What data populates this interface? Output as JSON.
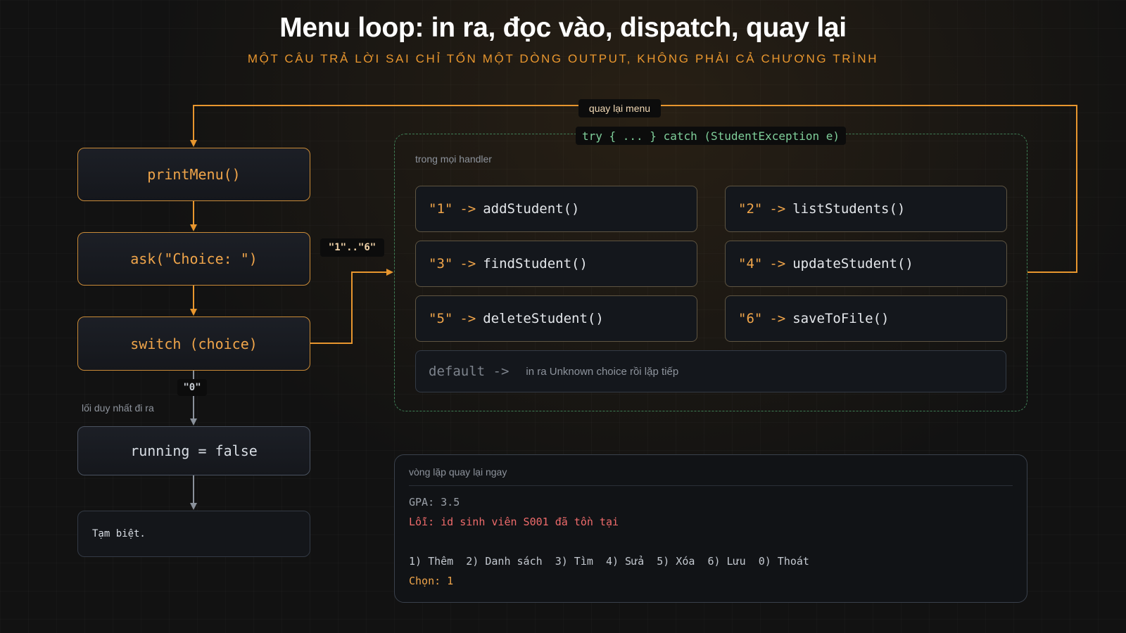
{
  "header": {
    "title": "Menu loop: in ra, đọc vào, dispatch, quay lại",
    "subtitle": "MỘT CÂU TRẢ LỜI SAI CHỈ TỐN MỘT DÒNG OUTPUT, KHÔNG PHẢI CẢ CHƯƠNG TRÌNH"
  },
  "flow": {
    "print_menu": "printMenu()",
    "ask": "ask(\"Choice: \")",
    "switch": "switch (choice)",
    "running_false": "running = false",
    "goodbye": "Tạm biệt."
  },
  "edges": {
    "loop_back": "quay lại menu",
    "range": "\"1\"..\"6\"",
    "zero": "\"0\"",
    "exit_note": "lối duy nhất đi ra"
  },
  "try_block": {
    "label": "try { ... } catch (StudentException e)",
    "note": "trong mọi handler",
    "cases": [
      {
        "key": "\"1\"",
        "arrow": "->",
        "fn": "addStudent()"
      },
      {
        "key": "\"2\"",
        "arrow": "->",
        "fn": "listStudents()"
      },
      {
        "key": "\"3\"",
        "arrow": "->",
        "fn": "findStudent()"
      },
      {
        "key": "\"4\"",
        "arrow": "->",
        "fn": "updateStudent()"
      },
      {
        "key": "\"5\"",
        "arrow": "->",
        "fn": "deleteStudent()"
      },
      {
        "key": "\"6\"",
        "arrow": "->",
        "fn": "saveToFile()"
      }
    ],
    "default_key": "default ->",
    "default_desc": "in ra Unknown choice rồi lặp tiếp"
  },
  "console": {
    "title": "vòng lặp quay lại ngay",
    "lines": [
      "GPA: 3.5",
      "Lỗi: id sinh viên S001 đã tồn tại",
      "1) Thêm  2) Danh sách  3) Tìm  4) Sửa  5) Xóa  6) Lưu  0) Thoát",
      "Chọn: 1"
    ]
  },
  "colors": {
    "accent": "#e8962e",
    "try_border": "#3e7e55",
    "error": "#ef6b6b"
  }
}
